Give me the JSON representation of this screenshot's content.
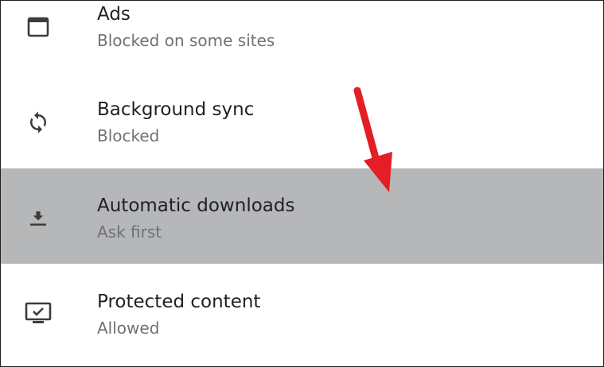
{
  "settings": {
    "items": [
      {
        "title": "Ads",
        "subtitle": "Blocked on some sites",
        "icon": "ads-window-icon"
      },
      {
        "title": "Background sync",
        "subtitle": "Blocked",
        "icon": "sync-icon"
      },
      {
        "title": "Automatic downloads",
        "subtitle": "Ask first",
        "icon": "download-icon",
        "selected": true
      },
      {
        "title": "Protected content",
        "subtitle": "Allowed",
        "icon": "protected-content-icon"
      }
    ]
  },
  "colors": {
    "selected_row": "#b6b7b8",
    "annotation_arrow": "#e31e25",
    "primary_text": "#202124",
    "secondary_text": "#6f7174"
  }
}
